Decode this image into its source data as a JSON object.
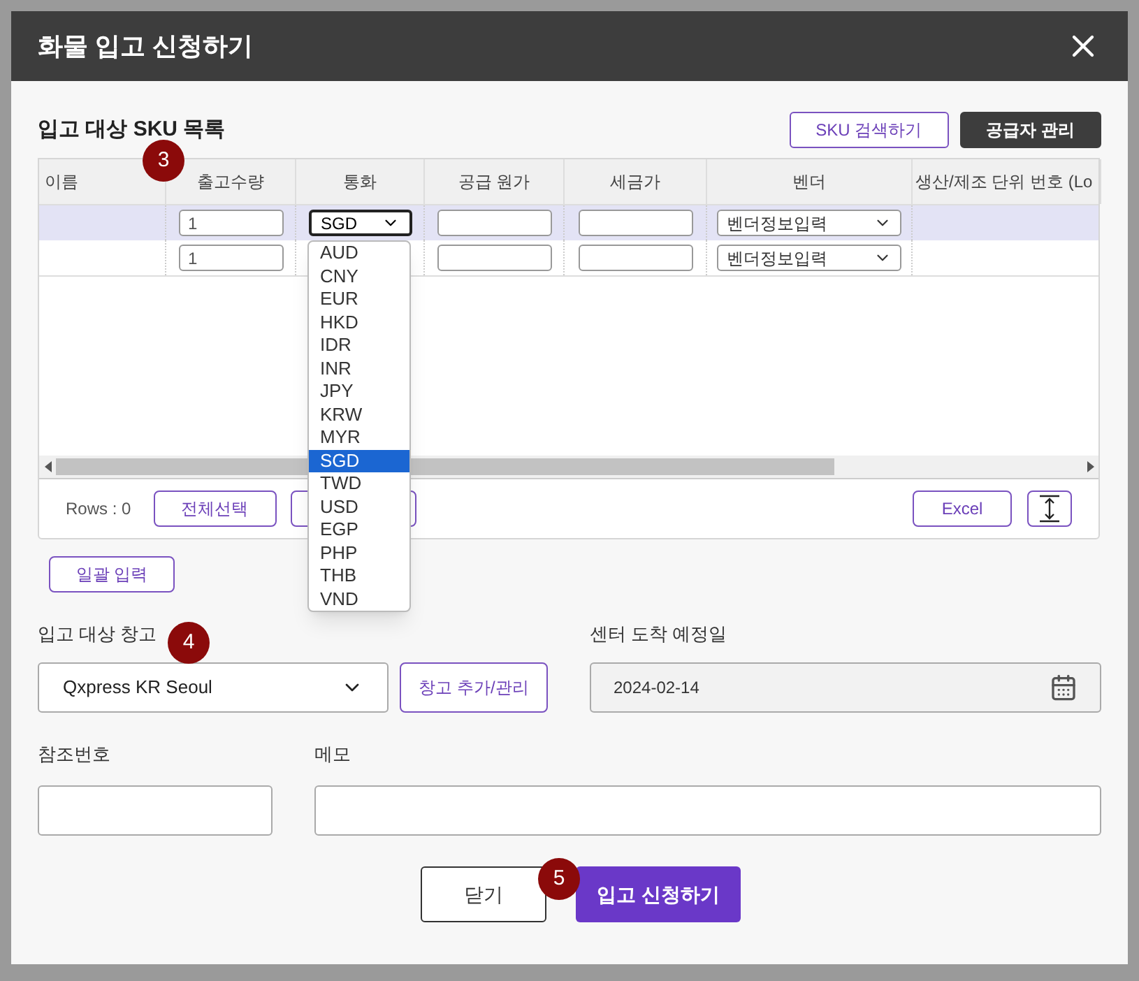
{
  "dialog": {
    "title": "화물 입고 신청하기"
  },
  "sku_section": {
    "title": "입고 대상 SKU 목록",
    "buttons": [
      {
        "label": "SKU 검색하기",
        "kind": "outline"
      },
      {
        "label": "공급자 관리",
        "kind": "dark"
      }
    ]
  },
  "table": {
    "columns": [
      "이름",
      "출고수량",
      "통화",
      "공급 원가",
      "세금가",
      "벤더",
      "생산/제조 단위 번호 (Lo"
    ],
    "rows": [
      {
        "selected": true,
        "quantity": "1",
        "currency": "SGD",
        "vendor": "벤더정보입력"
      },
      {
        "selected": false,
        "quantity": "1",
        "vendor": "벤더정보입력"
      }
    ],
    "footer": {
      "rows_count": "Rows : 0",
      "select_all": "전체선택",
      "excel": "Excel"
    }
  },
  "currency_dropdown": {
    "options": [
      {
        "label": "AUD",
        "selected": false
      },
      {
        "label": "CNY",
        "selected": false
      },
      {
        "label": "EUR",
        "selected": false
      },
      {
        "label": "HKD",
        "selected": false
      },
      {
        "label": "IDR",
        "selected": false
      },
      {
        "label": "INR",
        "selected": false
      },
      {
        "label": "JPY",
        "selected": false
      },
      {
        "label": "KRW",
        "selected": false
      },
      {
        "label": "MYR",
        "selected": false
      },
      {
        "label": "SGD",
        "selected": true
      },
      {
        "label": "TWD",
        "selected": false
      },
      {
        "label": "USD",
        "selected": false
      },
      {
        "label": "EGP",
        "selected": false
      },
      {
        "label": "PHP",
        "selected": false
      },
      {
        "label": "THB",
        "selected": false
      },
      {
        "label": "VND",
        "selected": false
      }
    ]
  },
  "bulk_input": "일괄 입력",
  "warehouse": {
    "label": "입고 대상 창고",
    "value": "Qxpress KR Seoul",
    "manage_button": "창고 추가/관리"
  },
  "arrival_date": {
    "label": "센터 도착 예정일",
    "value": "2024-02-14"
  },
  "reference": {
    "label": "참조번호"
  },
  "memo": {
    "label": "메모"
  },
  "actions": {
    "close": "닫기",
    "submit": "입고 신청하기"
  },
  "step_badges": [
    "3",
    "4",
    "5"
  ]
}
